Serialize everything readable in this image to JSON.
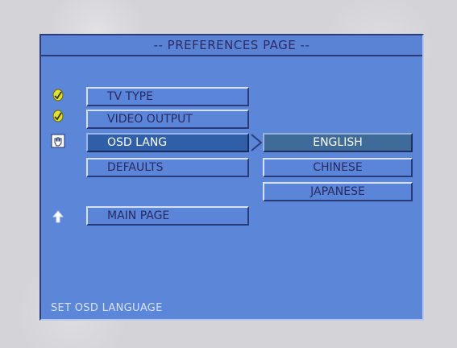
{
  "page": {
    "title": "-- PREFERENCES PAGE --"
  },
  "menu": {
    "items": [
      {
        "label": "TV TYPE",
        "icon": "checkmark-icon",
        "selected": false
      },
      {
        "label": "VIDEO OUTPUT",
        "icon": "checkmark-icon",
        "selected": false
      },
      {
        "label": "OSD LANG",
        "icon": "hand-pointer-icon",
        "selected": true
      },
      {
        "label": "DEFAULTS",
        "icon": null,
        "selected": false
      }
    ],
    "main_page": {
      "label": "MAIN PAGE",
      "icon": "up-arrow-icon"
    }
  },
  "submenu": {
    "items": [
      {
        "label": "ENGLISH",
        "selected": true
      },
      {
        "label": "CHINESE",
        "selected": false
      },
      {
        "label": "JAPANESE",
        "selected": false
      }
    ]
  },
  "status": {
    "text": "SET OSD LANGUAGE"
  },
  "colors": {
    "panel_blue": "#5c86d8",
    "selected_blue": "#2e5fa8",
    "text_dark": "#2a2a62",
    "text_light": "#ffffff"
  }
}
